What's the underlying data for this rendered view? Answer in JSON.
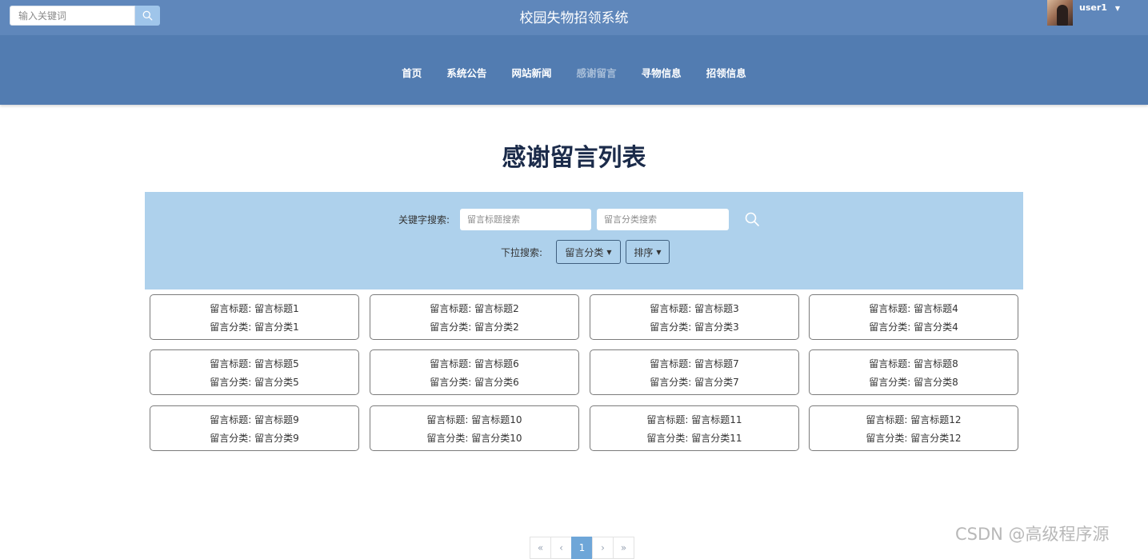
{
  "header": {
    "search_placeholder": "输入关键词",
    "site_title": "校园失物招领系统",
    "username": "user1"
  },
  "nav": {
    "items": [
      {
        "label": "首页",
        "active": false
      },
      {
        "label": "系统公告",
        "active": false
      },
      {
        "label": "网站新闻",
        "active": false
      },
      {
        "label": "感谢留言",
        "active": true
      },
      {
        "label": "寻物信息",
        "active": false
      },
      {
        "label": "招领信息",
        "active": false
      }
    ]
  },
  "page_title": "感谢留言列表",
  "filter": {
    "keyword_label": "关键字搜索:",
    "title_placeholder": "留言标题搜索",
    "category_placeholder": "留言分类搜索",
    "dropdown_label": "下拉搜索:",
    "category_dropdown": "留言分类",
    "sort_dropdown": "排序"
  },
  "cards": [
    {
      "title": "留言标题: 留言标题1",
      "category": "留言分类: 留言分类1"
    },
    {
      "title": "留言标题: 留言标题2",
      "category": "留言分类: 留言分类2"
    },
    {
      "title": "留言标题: 留言标题3",
      "category": "留言分类: 留言分类3"
    },
    {
      "title": "留言标题: 留言标题4",
      "category": "留言分类: 留言分类4"
    },
    {
      "title": "留言标题: 留言标题5",
      "category": "留言分类: 留言分类5"
    },
    {
      "title": "留言标题: 留言标题6",
      "category": "留言分类: 留言分类6"
    },
    {
      "title": "留言标题: 留言标题7",
      "category": "留言分类: 留言分类7"
    },
    {
      "title": "留言标题: 留言标题8",
      "category": "留言分类: 留言分类8"
    },
    {
      "title": "留言标题: 留言标题9",
      "category": "留言分类: 留言分类9"
    },
    {
      "title": "留言标题: 留言标题10",
      "category": "留言分类: 留言分类10"
    },
    {
      "title": "留言标题: 留言标题11",
      "category": "留言分类: 留言分类11"
    },
    {
      "title": "留言标题: 留言标题12",
      "category": "留言分类: 留言分类12"
    }
  ],
  "pagination": {
    "first": "«",
    "prev": "‹",
    "current": "1",
    "next": "›",
    "last": "»"
  },
  "watermark": "CSDN @高级程序源",
  "colors": {
    "topbar": "#5f87bb",
    "navbar": "#527cb1",
    "filter_bg": "#aed1ec",
    "active_page": "#6ea6d8"
  }
}
